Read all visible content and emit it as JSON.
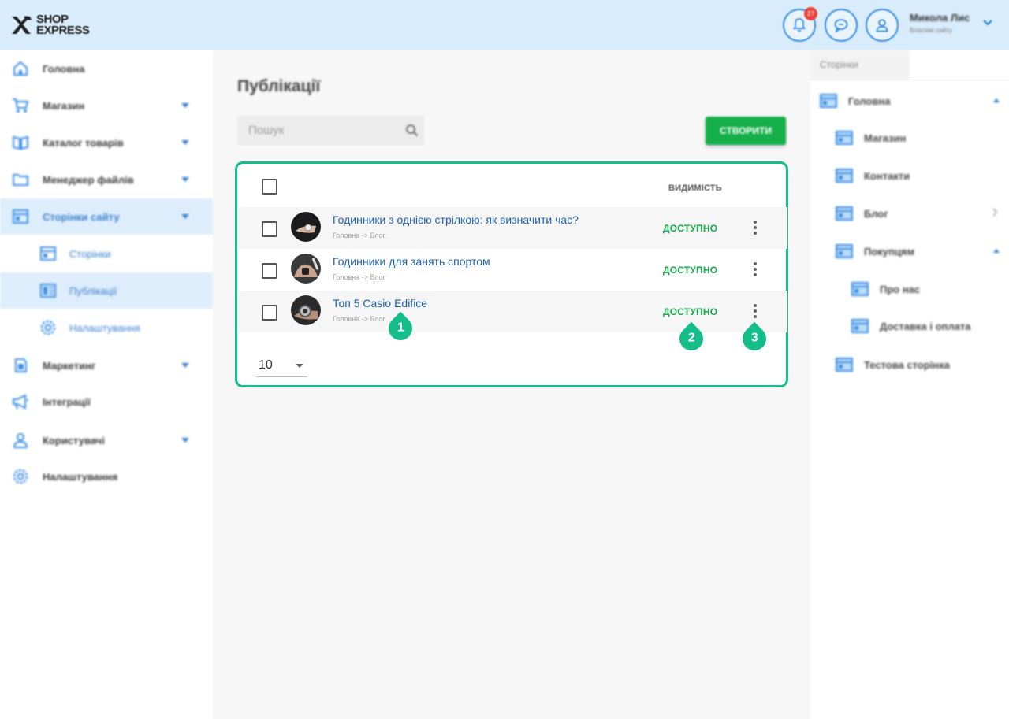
{
  "header": {
    "logo_line1": "SHOP",
    "logo_line2": "EXPRESS",
    "notification_count": "27",
    "user_name": "Микола Лис",
    "user_subtitle": "Власник сайту"
  },
  "sidebar": {
    "items": [
      {
        "label": "Головна",
        "icon": "home-icon"
      },
      {
        "label": "Магазин",
        "icon": "cart-icon",
        "expandable": true
      },
      {
        "label": "Каталог товарів",
        "icon": "catalog-icon",
        "expandable": true
      },
      {
        "label": "Менеджер файлів",
        "icon": "folder-icon",
        "expandable": true
      },
      {
        "label": "Сторінки сайту",
        "icon": "pages-icon",
        "expandable": true,
        "active": true
      },
      {
        "label": "Сторінки",
        "icon": "page-icon",
        "sub": true
      },
      {
        "label": "Публікації",
        "icon": "publications-icon",
        "sub": true,
        "active": true
      },
      {
        "label": "Налаштування",
        "icon": "gear-icon",
        "sub": true
      },
      {
        "label": "Маркетинг",
        "icon": "marketing-icon",
        "expandable": true
      },
      {
        "label": "Інтеграції",
        "icon": "megaphone-icon"
      },
      {
        "label": "Користувачі",
        "icon": "users-icon",
        "expandable": true
      },
      {
        "label": "Налаштування",
        "icon": "gear-icon"
      }
    ]
  },
  "main": {
    "title": "Публікації",
    "search_placeholder": "Пошук",
    "create_label": "СТВОРИТИ",
    "visibility_header": "ВИДИМІСТЬ",
    "rows": [
      {
        "title": "Годинники з однією стрілкою: як визначити час?",
        "path": "Головна -> Блог",
        "status": "ДОСТУПНО"
      },
      {
        "title": "Годинники для занять спортом",
        "path": "Головна -> Блог",
        "status": "ДОСТУПНО"
      },
      {
        "title": "Топ 5 Casio Edifice",
        "path": "Головна -> Блог",
        "status": "ДОСТУПНО"
      }
    ],
    "per_page": "10",
    "markers": [
      "1",
      "2",
      "3"
    ]
  },
  "right_panel": {
    "tab_label": "Сторінки",
    "tree": [
      {
        "label": "Головна",
        "level": 0,
        "state": "expanded"
      },
      {
        "label": "Магазин",
        "level": 1
      },
      {
        "label": "Контакти",
        "level": 1
      },
      {
        "label": "Блог",
        "level": 1,
        "state": "collapsed"
      },
      {
        "label": "Покупцям",
        "level": 1,
        "state": "expanded"
      },
      {
        "label": "Про нас",
        "level": 2
      },
      {
        "label": "Доставка і оплата",
        "level": 2
      },
      {
        "label": "Тестова сторінка",
        "level": 1
      }
    ]
  },
  "colors": {
    "accent_blue": "#3a8ee6",
    "header_bg": "#d9ecfb",
    "create_green": "#15b04a",
    "status_green": "#17a84a",
    "highlight_teal": "#14bd8a"
  }
}
